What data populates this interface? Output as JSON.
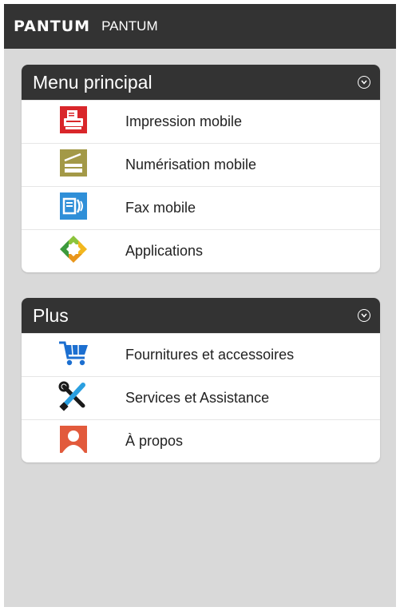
{
  "app": {
    "logo_text": "PANTUM",
    "name": "PANTUM"
  },
  "sections": [
    {
      "title": "Menu principal",
      "items": [
        {
          "label": "Impression mobile",
          "icon": "printer-icon"
        },
        {
          "label": "Numérisation mobile",
          "icon": "scanner-icon"
        },
        {
          "label": "Fax mobile",
          "icon": "fax-icon"
        },
        {
          "label": "Applications",
          "icon": "applications-icon"
        }
      ]
    },
    {
      "title": "Plus",
      "items": [
        {
          "label": "Fournitures et accessoires",
          "icon": "shopping-cart-icon"
        },
        {
          "label": "Services et Assistance",
          "icon": "tools-icon"
        },
        {
          "label": "À propos",
          "icon": "user-profile-icon"
        }
      ]
    }
  ],
  "colors": {
    "appbar": "#333333",
    "background": "#d9d9d9",
    "card": "#ffffff",
    "printer_red": "#d9262a",
    "scanner_olive": "#9a8f3c",
    "fax_blue": "#2f8fd8",
    "cart_blue": "#1c6fd0",
    "profile_red": "#e25a3c"
  }
}
